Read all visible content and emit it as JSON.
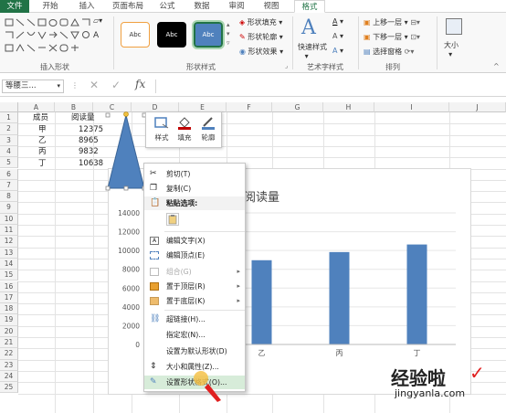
{
  "tabs": [
    "文件",
    "开始",
    "插入",
    "页面布局",
    "公式",
    "数据",
    "审阅",
    "视图",
    "格式"
  ],
  "active_tab": "格式",
  "ribbon": {
    "insert_shapes_label": "插入形状",
    "shape_styles_label": "形状样式",
    "style_thumb_text": "Abc",
    "shape_fill": "形状填充",
    "shape_outline": "形状轮廓",
    "shape_effects": "形状效果",
    "art_styles_label": "艺术字样式",
    "quick_styles": "快速样式",
    "bring_forward": "上移一层",
    "send_backward": "下移一层",
    "selection_pane": "选择窗格",
    "arrange_label": "排列",
    "size": "大小"
  },
  "formula_bar": {
    "name_box": "等腰三...",
    "fx": "fx",
    "value": ""
  },
  "columns": [
    "A",
    "B",
    "C",
    "D",
    "E",
    "F",
    "G",
    "H",
    "I",
    "J"
  ],
  "rows": [
    "1",
    "2",
    "3",
    "4",
    "5",
    "6",
    "7",
    "8",
    "9",
    "10",
    "11",
    "12",
    "13",
    "14",
    "15",
    "16",
    "17",
    "18",
    "19",
    "20",
    "21",
    "22",
    "23",
    "24",
    "25"
  ],
  "table": {
    "header": [
      "成员",
      "阅读量"
    ],
    "rows": [
      [
        "甲",
        "12375"
      ],
      [
        "乙",
        "8965"
      ],
      [
        "丙",
        "9832"
      ],
      [
        "丁",
        "10638"
      ]
    ]
  },
  "chart_data": {
    "type": "bar",
    "title": "阅读量",
    "categories": [
      "甲",
      "乙",
      "丙",
      "丁"
    ],
    "values": [
      12375,
      8965,
      9832,
      10638
    ],
    "ylim": [
      0,
      14000
    ],
    "yticks": [
      "0",
      "2000",
      "4000",
      "6000",
      "8000",
      "10000",
      "12000",
      "14000"
    ],
    "visible_categories": [
      "丙",
      "丁"
    ],
    "bar_color": "#4f81bd"
  },
  "mini_toolbar": [
    "样式",
    "填充",
    "轮廓"
  ],
  "context_menu": {
    "items": [
      {
        "label": "剪切(T)",
        "icon": "scissors-icon",
        "disabled": false
      },
      {
        "label": "复制(C)",
        "icon": "copy-icon",
        "disabled": false
      },
      {
        "label": "粘贴选项:",
        "icon": "paste-icon",
        "disabled": false
      },
      {
        "label": "",
        "icon": "paste-option-icon",
        "disabled": false
      },
      {
        "label": "编辑文字(X)",
        "icon": "edit-text-icon",
        "disabled": false
      },
      {
        "label": "编辑顶点(E)",
        "icon": "edit-points-icon",
        "disabled": false
      },
      {
        "label": "组合(G)",
        "icon": "group-icon",
        "disabled": true,
        "submenu": true
      },
      {
        "label": "置于顶层(R)",
        "icon": "bring-front-icon",
        "disabled": false,
        "submenu": true
      },
      {
        "label": "置于底层(K)",
        "icon": "send-back-icon",
        "disabled": false,
        "submenu": true
      },
      {
        "label": "超链接(H)...",
        "icon": "hyperlink-icon",
        "disabled": false
      },
      {
        "label": "指定宏(N)...",
        "icon": "",
        "disabled": false
      },
      {
        "label": "设置为默认形状(D)",
        "icon": "",
        "disabled": false
      },
      {
        "label": "大小和属性(Z)...",
        "icon": "size-icon",
        "disabled": false
      },
      {
        "label": "设置形状格式(O)...",
        "icon": "format-shape-icon",
        "disabled": false,
        "highlighted": true
      }
    ]
  },
  "watermark": {
    "text1": "经验啦",
    "text2": "jingyanla.com"
  },
  "colors": {
    "excel_green": "#217346",
    "shape_blue": "#4f81bd",
    "highlight": "#d7ecd9"
  }
}
